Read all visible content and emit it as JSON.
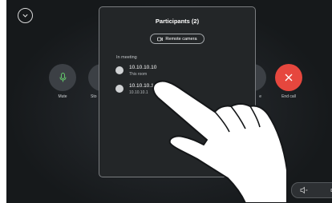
{
  "controls": {
    "mute_label": "Mute",
    "stop_label": "Sto",
    "right_label": "e",
    "end_call_label": "End call"
  },
  "panel": {
    "title": "Participants (2)",
    "remote_camera_label": "Remote camera",
    "section_label": "In meeting",
    "participants": [
      {
        "name": "10.10.10.10",
        "subtitle": "This room"
      },
      {
        "name": "10.10.10.11",
        "subtitle": "10.10.10.1"
      }
    ]
  },
  "colors": {
    "end_call": "#e6473e",
    "background": "#1a1d20",
    "panel": "#232628"
  },
  "icons": [
    "chevron-down-icon",
    "microphone-icon",
    "video-camera-icon",
    "close-icon",
    "speaker-icon"
  ]
}
